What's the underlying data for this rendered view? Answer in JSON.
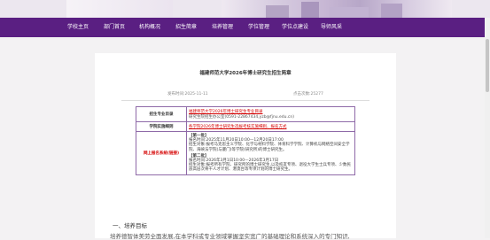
{
  "nav": {
    "items": [
      "学校主页",
      "部门首页",
      "机构概况",
      "招生简章",
      "培养管理",
      "学位管理",
      "学位点建设",
      "导师风采"
    ]
  },
  "article": {
    "title": "福建师范大学2026年博士研究生招生简章",
    "date_label": "发布时间:2025-11-11",
    "views_label": "点击次数:25277",
    "table": {
      "row1": {
        "label": "招生专业目录",
        "link": "福建师范大学2026年博士研究生专业目录",
        "contact": "研究生院招生办公室(0591-22867434,yzb@fjnu.edu.cn)"
      },
      "row2": {
        "label": "学院实施细则",
        "link": "各学院2026年博士研究生选拔考核实施细则、报名方式"
      },
      "row3": {
        "label": "网上报名系统(链接)",
        "batch1": {
          "heading": "【第一批】",
          "time": "报名时间:2025年11月20日10:00—12月20日17:00",
          "scope": "招生对象:报考马克思主义学院、化学与材料学院、体育科学学院、计算机与网络空间安全学院、海峡法学院(与厦门)等学院(研究所)的博士研究生。"
        },
        "batch2": {
          "heading": "【第二批】",
          "time": "报名时间:2026年3月1日10:00—2026年3月17日",
          "scope": "招生对象:报考所有学院、研究所的博士研究生,以及校友专项、退役大学生士兵专项、少数民族高层次骨干人才计划、港澳台等专项计划的博士研究生。"
        }
      }
    },
    "section": {
      "title": "一、培养目标",
      "text": "培养德智体美劳全面发展,在本学科或专业领域掌握坚实宽广的基础理论和系统深入的专门知识,"
    }
  },
  "colors": {
    "nav_bg": "#5a1f82",
    "accent_red": "#d40000",
    "table_border": "#8f6aa8"
  }
}
